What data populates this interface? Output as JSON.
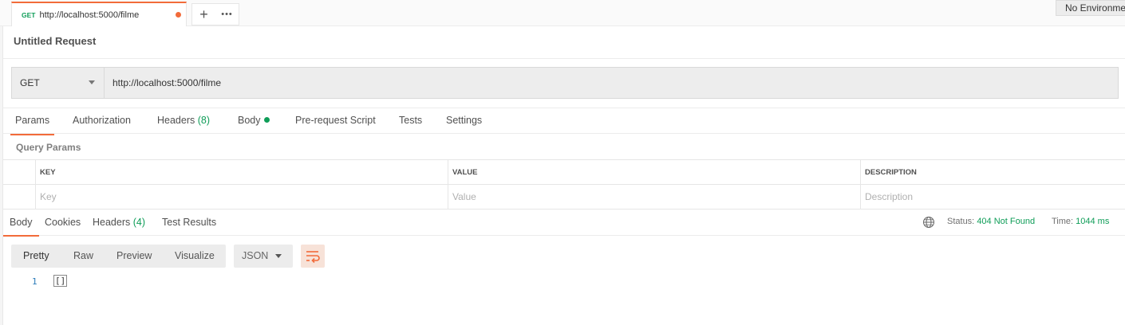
{
  "tab": {
    "method": "GET",
    "url": "http://localhost:5000/filme"
  },
  "tab_actions": {
    "plus": "+",
    "more": "•••"
  },
  "environment": {
    "label": "No Environment"
  },
  "request": {
    "name": "Untitled Request",
    "method": "GET",
    "url": "http://localhost:5000/filme"
  },
  "request_tabs": {
    "params": "Params",
    "authorization": "Authorization",
    "headers": "Headers",
    "headers_count": "(8)",
    "body": "Body",
    "pre_request": "Pre-request Script",
    "tests": "Tests",
    "settings": "Settings"
  },
  "query_params": {
    "title": "Query Params",
    "columns": [
      "KEY",
      "VALUE",
      "DESCRIPTION"
    ],
    "placeholders": [
      "Key",
      "Value",
      "Description"
    ]
  },
  "response_tabs": {
    "body": "Body",
    "cookies": "Cookies",
    "headers": "Headers",
    "headers_count": "(4)",
    "test_results": "Test Results"
  },
  "response_status": {
    "status_label": "Status:",
    "status_value": "404 Not Found",
    "time_label": "Time:",
    "time_value": "1044 ms"
  },
  "response_toolbar": {
    "views": [
      "Pretty",
      "Raw",
      "Preview",
      "Visualize"
    ],
    "format": "JSON"
  },
  "response_body": {
    "line_number": "1",
    "content": "[]"
  },
  "colors": {
    "accent": "#f26b3a",
    "success": "#0f9d58"
  }
}
